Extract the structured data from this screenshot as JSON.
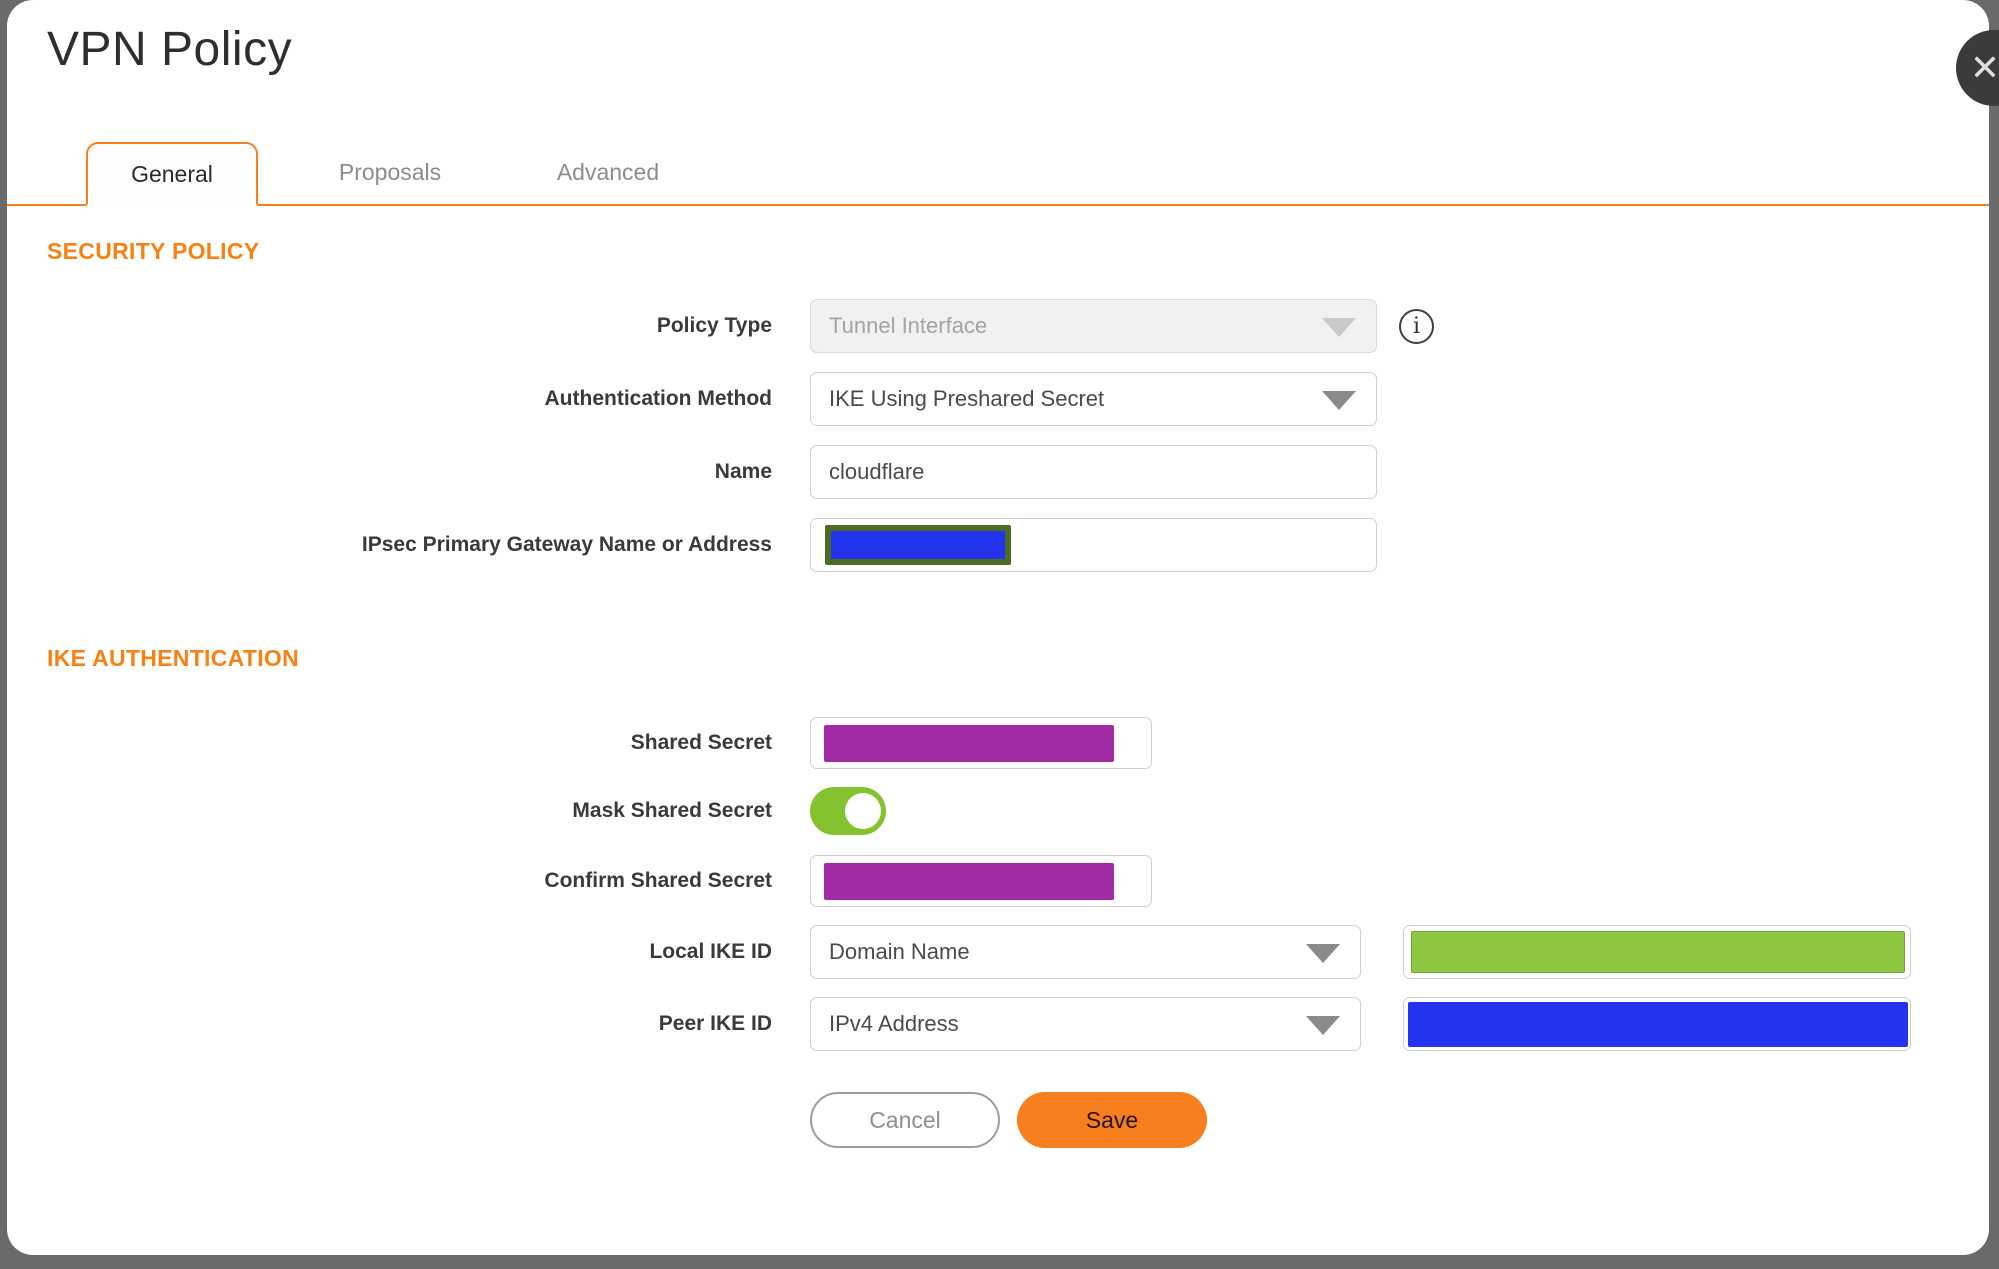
{
  "window": {
    "title": "VPN Policy",
    "close_glyph": "✕"
  },
  "tabs": [
    {
      "label": "General",
      "active": true
    },
    {
      "label": "Proposals",
      "active": false
    },
    {
      "label": "Advanced",
      "active": false
    }
  ],
  "security_policy": {
    "heading": "SECURITY POLICY",
    "policy_type": {
      "label": "Policy Type",
      "value": "Tunnel Interface",
      "disabled": true
    },
    "authentication_method": {
      "label": "Authentication Method",
      "value": "IKE Using Preshared Secret"
    },
    "name": {
      "label": "Name",
      "value": "cloudflare"
    },
    "ipsec_primary_gateway": {
      "label": "IPsec Primary Gateway Name or Address",
      "value_redacted": true
    }
  },
  "ike_authentication": {
    "heading": "IKE AUTHENTICATION",
    "shared_secret": {
      "label": "Shared Secret",
      "value_redacted": true
    },
    "mask_shared_secret": {
      "label": "Mask Shared Secret",
      "state": "on"
    },
    "confirm_shared_secret": {
      "label": "Confirm Shared Secret",
      "value_redacted": true
    },
    "local_ike_id": {
      "label": "Local IKE ID",
      "value": "Domain Name",
      "value_redacted": true
    },
    "peer_ike_id": {
      "label": "Peer IKE ID",
      "value": "IPv4 Address",
      "value_redacted": true
    }
  },
  "info_icon_glyph": "i",
  "actions": {
    "cancel": "Cancel",
    "save": "Save"
  },
  "colors": {
    "accent_orange": "#F77F1E",
    "redaction_blue": "#2433EE",
    "redaction_purple": "#A12BA5",
    "redaction_green": "#8DC63F",
    "redaction_olive_border": "#4E6B25",
    "toggle_green": "#84C32D"
  }
}
